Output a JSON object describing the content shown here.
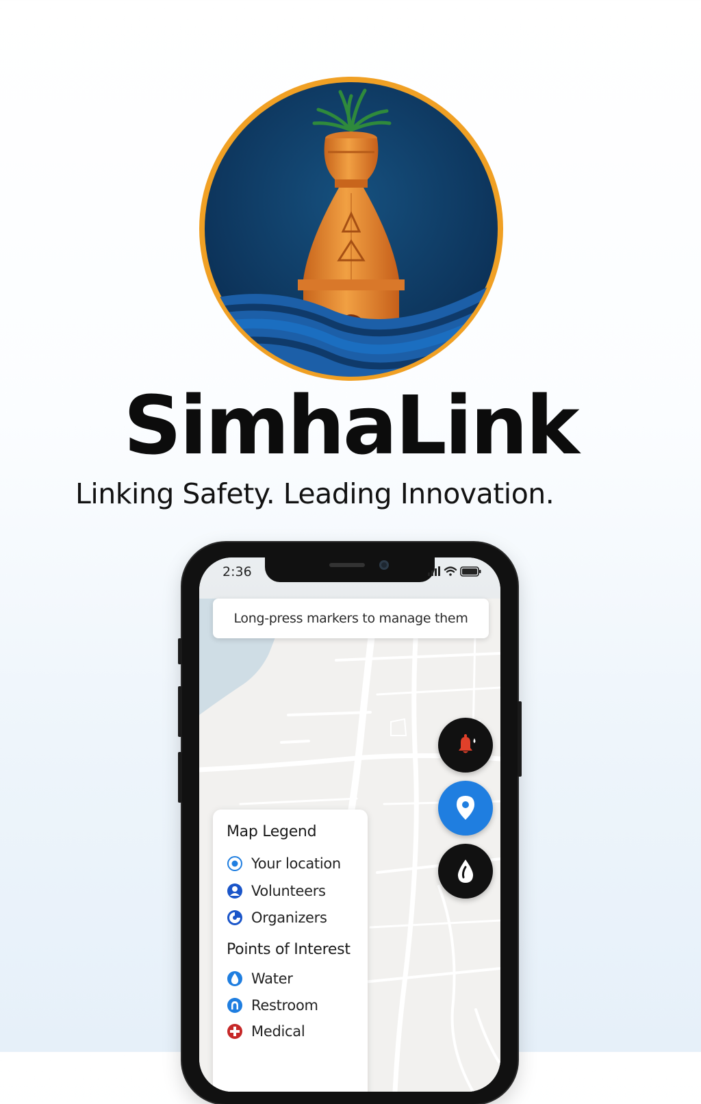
{
  "brand": {
    "name": "SimhaLink",
    "tagline": "Linking Safety. Leading Innovation."
  },
  "status_bar": {
    "time": "2:36"
  },
  "map": {
    "toast": "Long-press markers to manage them",
    "fab_buttons": [
      {
        "icon": "alert-bell-icon",
        "color": "#111111"
      },
      {
        "icon": "location-pin-icon",
        "color": "#1f7ee0"
      },
      {
        "icon": "water-drop-icon",
        "color": "#111111"
      }
    ]
  },
  "legend": {
    "title": "Map Legend",
    "items": [
      {
        "label": "Your location",
        "icon": "your-location-icon"
      },
      {
        "label": "Volunteers",
        "icon": "volunteer-icon"
      },
      {
        "label": "Organizers",
        "icon": "organizer-icon"
      }
    ],
    "poi_title": "Points of Interest",
    "poi_items": [
      {
        "label": "Water",
        "icon": "water-icon"
      },
      {
        "label": "Restroom",
        "icon": "restroom-icon"
      },
      {
        "label": "Medical",
        "icon": "medical-icon"
      }
    ]
  },
  "colors": {
    "logo_navy": "#0f3b66",
    "logo_ring": "#f0a024",
    "temple_orange": "#e98a2c",
    "wave_blue": "#1c64b0",
    "primary_blue": "#1f7ee0",
    "medical_red": "#c62828"
  }
}
